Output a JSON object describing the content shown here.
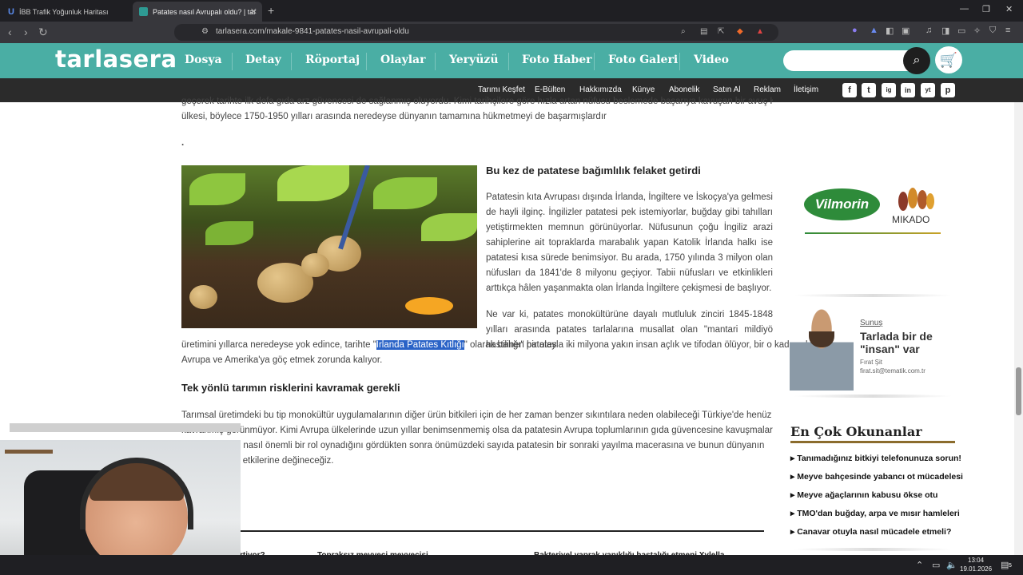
{
  "browser": {
    "tabs": [
      {
        "title": "İBB Trafik Yoğunluk Haritası"
      },
      {
        "title": "Patates nasıl Avrupalı oldu? | tar"
      }
    ],
    "url": "tarlasera.com/makale-9841-patates-nasil-avrupali-oldu"
  },
  "site": {
    "logo": "tarlasera",
    "main_nav": [
      "Dosya",
      "Detay",
      "Röportaj",
      "Olaylar",
      "Yeryüzü",
      "Foto Haber",
      "Foto Galeri",
      "Video"
    ],
    "search_placeholder": "",
    "sub_nav": [
      "Tarımı Keşfet",
      "E-Bülten",
      "Hakkımızda",
      "Künye",
      "Abonelik",
      "Satın Al",
      "Reklam",
      "İletişim"
    ],
    "social": [
      "f",
      "t",
      "ig",
      "in",
      "yt",
      "p"
    ]
  },
  "article": {
    "intro_line1": "geçerek tarihte ilk defa gıda arz güvencesi de sağlanmış oluyordu. Kimi tarihçilere göre hızla artan nüfusu beslemede başarıya kavuşan bir avuç Kuzey Avrupa",
    "intro_line2": "ülkesi, böylece 1750-1950 yılları arasında neredeyse dünyanın tamamına hükmetmeyi de başarmışlardır",
    "dot": ".",
    "section1_title": "Bu kez de patatese bağımlılık felaket getirdi",
    "section1_para": "Patatesin kıta Avrupası dışında İrlanda, İngiltere ve İskoçya'ya gelmesi de hayli ilginç. İngilizler patatesi pek istemiyorlar, buğday gibi tahılları yetiştirmekten memnun görünüyorlar. Nüfusunun çoğu İngiliz arazi sahiplerine ait topraklarda marabalık yapan Katolik İrlanda halkı ise patatesi kısa sürede benimsiyor. Bu arada, 1750 yılında 3 milyon olan nüfusları da 1841'de 8 milyonu geçiyor. Tabii nüfusları ve etkinlikleri arttıkça hâlen yaşanmakta olan İrlanda İngiltere çekişmesi de başlıyor.",
    "section1_para2a": "Ne var ki, patates monokültürüne dayalı mutluluk zinciri 1845-1848 yılları arasında patates tarlalarına musallat olan \"mantari mildiyö hastalığı\" patates",
    "section1_para2b_pre": "üretimini yıllarca neredeyse yok edince, tarihte \"",
    "section1_highlight": "İrlanda Patates Kıtlığı",
    "section1_para2b_post": "\" olarak bilinen bir olayla iki milyona yakın insan açlık ve tifodan ölüyor, bir o kadarı da",
    "section1_para2c": "Avrupa ve Amerika'ya göç etmek zorunda kalıyor.",
    "section2_title": "Tek yönlü tarımın risklerini kavramak gerekli",
    "section2_line1": "Tarımsal üretimdeki bu tip monokültür uygulamalarının diğer ürün bitkileri için de her zaman benzer sıkıntılara neden olabileceği Türkiye'de henüz yeterince",
    "section2_line2": "kavranmış görünmüyor. Kimi Avrupa ülkelerinde uzun yıllar benimsenmemiş olsa da patatesin Avrupa toplumlarının gıda güvencesine kavuşmalarında ve",
    "section2_line3": "gelişmelerinde nasıl önemli bir rol oynadığını gördükten sonra önümüzdeki sayıda patatesin bir sonraki yayılma macerasına ve bunun dünyanın",
    "section2_line4": "deki toplumsal etkilerine değineceğiz.",
    "bottom_links": [
      "rtiyor?",
      "Topraksız meyveci meyvecisi",
      "Bakteriyel yaprak yanıklığı hastalığı etmeni Xylella"
    ]
  },
  "sidebar": {
    "sponsor1": "Vilmorin",
    "sponsor2": "MIKADO",
    "card_label": "Sunuş",
    "card_title": "Tarlada bir de \"insan\" var",
    "card_author": "Fırat Şit",
    "card_email": "firat.sit@tematik.com.tr",
    "popular_title": "En Çok Okunanlar",
    "popular_items": [
      "Tanımadığınız bitkiyi telefonunuza sorun!",
      "Meyve bahçesinde yabancı ot mücadelesi",
      "Meyve ağaçlarının kabusu ökse otu",
      "TMO'dan buğday, arpa ve mısır hamleleri",
      "Canavar otuyla nasıl mücadele etmeli?"
    ]
  },
  "taskbar": {
    "time": "13:04",
    "date": "19.01.2026",
    "notif": "5"
  },
  "colors": {
    "header": "#4aaea4",
    "subnav": "#2b2b2b",
    "highlight": "#2a63c7",
    "popular_line": "#8b6c2d"
  }
}
